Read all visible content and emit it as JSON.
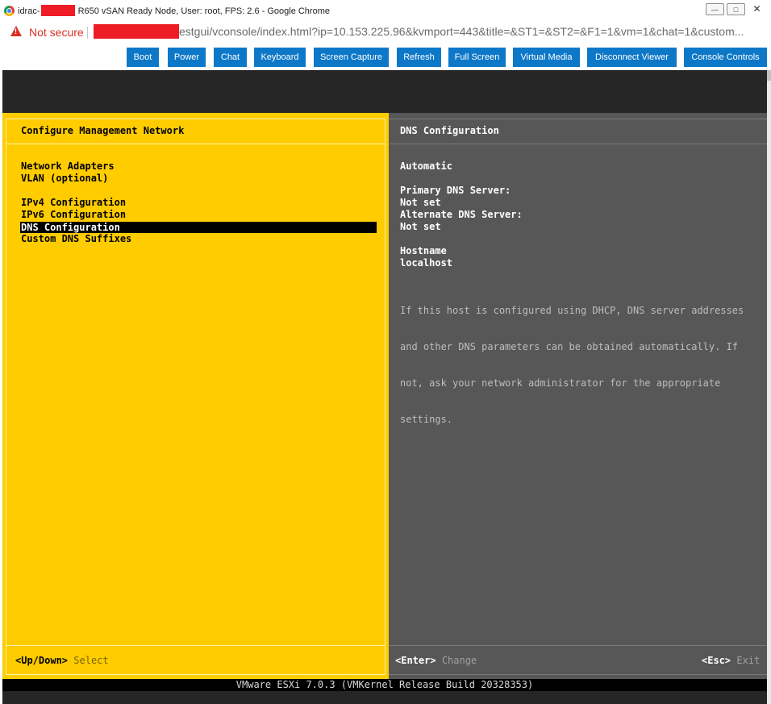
{
  "window": {
    "title_prefix": "idrac-",
    "title_suffix": " R650 vSAN Ready Node, User: root, FPS: 2.6 - Google Chrome",
    "minimize": "—",
    "maximize": "□",
    "close": "✕"
  },
  "address": {
    "security_label": "Not secure",
    "url_visible": "estgui/vconsole/index.html?ip=10.153.225.96&kvmport=443&title=&ST1=&ST2=&F1=1&vm=1&chat=1&custom..."
  },
  "toolbar": {
    "color": "#0e78c8",
    "buttons": [
      "Boot",
      "Power",
      "Chat",
      "Keyboard",
      "Screen Capture",
      "Refresh",
      "Full Screen",
      "Virtual Media",
      "Disconnect Viewer",
      "Console Controls"
    ]
  },
  "dcui": {
    "left_title": "Configure Management Network",
    "menu": [
      "Network Adapters",
      "VLAN (optional)",
      "IPv4 Configuration",
      "IPv6 Configuration",
      "DNS Configuration",
      "Custom DNS Suffixes"
    ],
    "selected_item": "DNS Configuration",
    "right_title": "DNS Configuration",
    "mode": "Automatic",
    "primary_dns_label": "Primary DNS Server:",
    "primary_dns_value": "Not set",
    "alternate_dns_label": "Alternate DNS Server:",
    "alternate_dns_value": "Not set",
    "hostname_label": "Hostname",
    "hostname_value": "localhost",
    "help_lines": [
      "If this host is configured using DHCP, DNS server addresses",
      "and other DNS parameters can be obtained automatically. If",
      "not, ask your network administrator for the appropriate",
      "settings."
    ],
    "footer": {
      "updown_key": "<Up/Down>",
      "updown_action": "Select",
      "enter_key": "<Enter>",
      "enter_action": "Change",
      "esc_key": "<Esc>",
      "esc_action": "Exit"
    },
    "status_line": "VMware ESXi 7.0.3 (VMKernel Release Build 20328353)",
    "colors": {
      "left_panel": "#ffcc00",
      "right_panel": "#575757"
    }
  }
}
